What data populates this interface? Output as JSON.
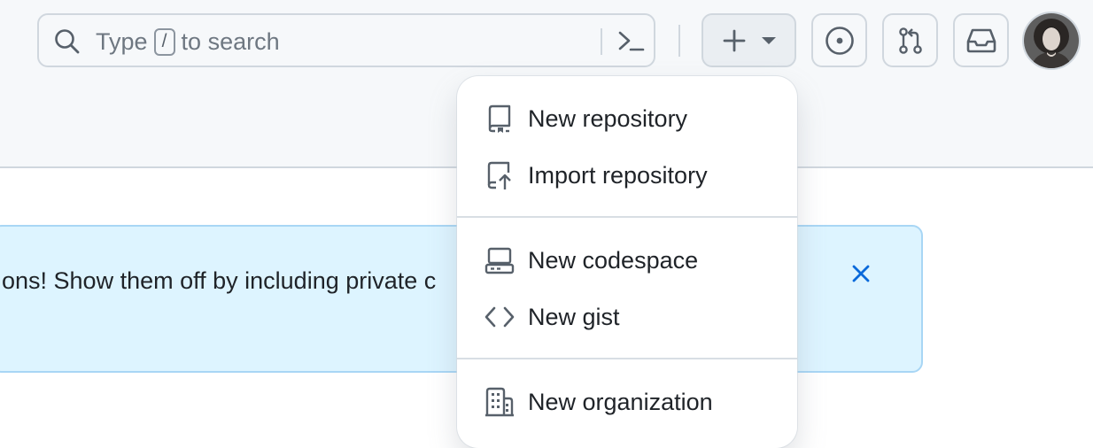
{
  "header": {
    "search": {
      "placeholder_before": "Type",
      "shortcut_key": "/",
      "placeholder_after": "to search"
    },
    "icons": {
      "search": "search-icon",
      "command_palette": "terminal-icon",
      "create": "plus-icon",
      "create_dropdown": "triangle-down-icon",
      "issues": "issue-opened-icon",
      "pull_requests": "git-pull-request-icon",
      "inbox": "inbox-icon"
    }
  },
  "create_menu": {
    "groups": [
      [
        {
          "label": "New repository",
          "icon": "repo-icon"
        },
        {
          "label": "Import repository",
          "icon": "repo-push-icon"
        }
      ],
      [
        {
          "label": "New codespace",
          "icon": "codespaces-icon"
        },
        {
          "label": "New gist",
          "icon": "code-icon"
        }
      ],
      [
        {
          "label": "New organization",
          "icon": "organization-icon"
        }
      ]
    ]
  },
  "banner": {
    "text": "ons! Show them off by including private c"
  },
  "colors": {
    "header_bg": "#f6f8fa",
    "banner_bg": "#ddf4ff",
    "banner_border": "#a8d6f5",
    "accent_blue": "#0969da",
    "icon_gray": "#57606a"
  }
}
